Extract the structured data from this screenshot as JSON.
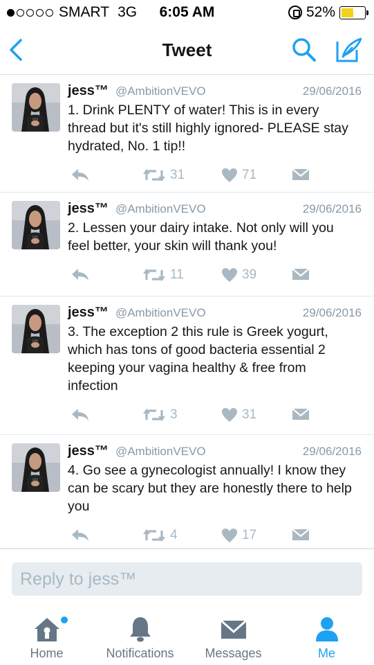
{
  "status_bar": {
    "signal_dots": 5,
    "signal_filled": 1,
    "carrier": "SMART",
    "network": "3G",
    "time": "6:05 AM",
    "battery_percent": "52%",
    "battery_level": 0.52
  },
  "nav": {
    "title": "Tweet",
    "back_icon": "back-chevron-icon",
    "search_icon": "search-icon",
    "compose_icon": "compose-icon"
  },
  "tweets": [
    {
      "name": "jess™",
      "handle": "@AmbitionVEVO",
      "date": "29/06/2016",
      "text": "1. Drink PLENTY of water! This is in every thread but it's still highly ignored- PLEASE stay hydrated, No. 1 tip!!",
      "retweets": "31",
      "likes": "71"
    },
    {
      "name": "jess™",
      "handle": "@AmbitionVEVO",
      "date": "29/06/2016",
      "text": "2. Lessen your dairy intake. Not only will you feel better, your skin will thank you!",
      "retweets": "11",
      "likes": "39"
    },
    {
      "name": "jess™",
      "handle": "@AmbitionVEVO",
      "date": "29/06/2016",
      "text": "3. The exception 2 this rule is Greek yogurt, which has tons of good bacteria essential 2 keeping your vagina healthy & free from infection",
      "retweets": "3",
      "likes": "31"
    },
    {
      "name": "jess™",
      "handle": "@AmbitionVEVO",
      "date": "29/06/2016",
      "text": "4. Go see a gynecologist annually! I know they can be scary but they are honestly there to help you",
      "retweets": "4",
      "likes": "17"
    }
  ],
  "reply": {
    "placeholder": "Reply to jess™"
  },
  "tabs": [
    {
      "label": "Home",
      "icon": "home-icon",
      "active": false,
      "has_badge": true
    },
    {
      "label": "Notifications",
      "icon": "bell-icon",
      "active": false
    },
    {
      "label": "Messages",
      "icon": "envelope-icon",
      "active": false
    },
    {
      "label": "Me",
      "icon": "person-icon",
      "active": true
    }
  ],
  "colors": {
    "accent": "#1da1f2",
    "action_gray": "#aab8c2",
    "secondary_text": "#8899a6",
    "battery_fill": "#f5d21a"
  }
}
